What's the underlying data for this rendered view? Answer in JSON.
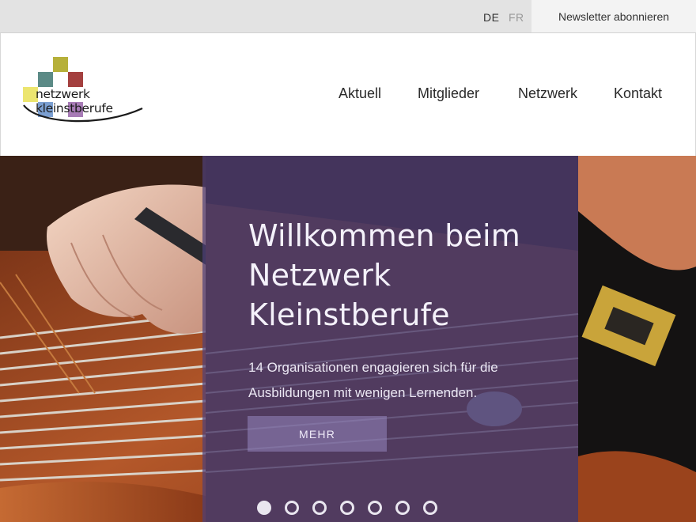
{
  "topbar": {
    "languages": [
      "DE",
      "FR"
    ],
    "newsletter_label": "Newsletter abonnieren"
  },
  "logo": {
    "wordmark": "netzwerk kleinstberufe",
    "colors": [
      "#b6b03a",
      "#5b8a86",
      "#a4403f",
      "#ece56f",
      "#7b9fd1",
      "#a77bb6"
    ]
  },
  "nav": {
    "items": [
      "Aktuell",
      "Mitglieder",
      "Netzwerk",
      "Kontakt"
    ]
  },
  "hero": {
    "title_lines": [
      "Willkommen beim",
      "Netzwerk",
      "Kleinstberufe"
    ],
    "text": "14 Organisationen engagieren sich für die Ausbildungen mit wenigen Lernenden.",
    "button_label": "MEHR",
    "slides_total": 7,
    "active_slide": 1,
    "overlay_color": "#4e4078"
  }
}
